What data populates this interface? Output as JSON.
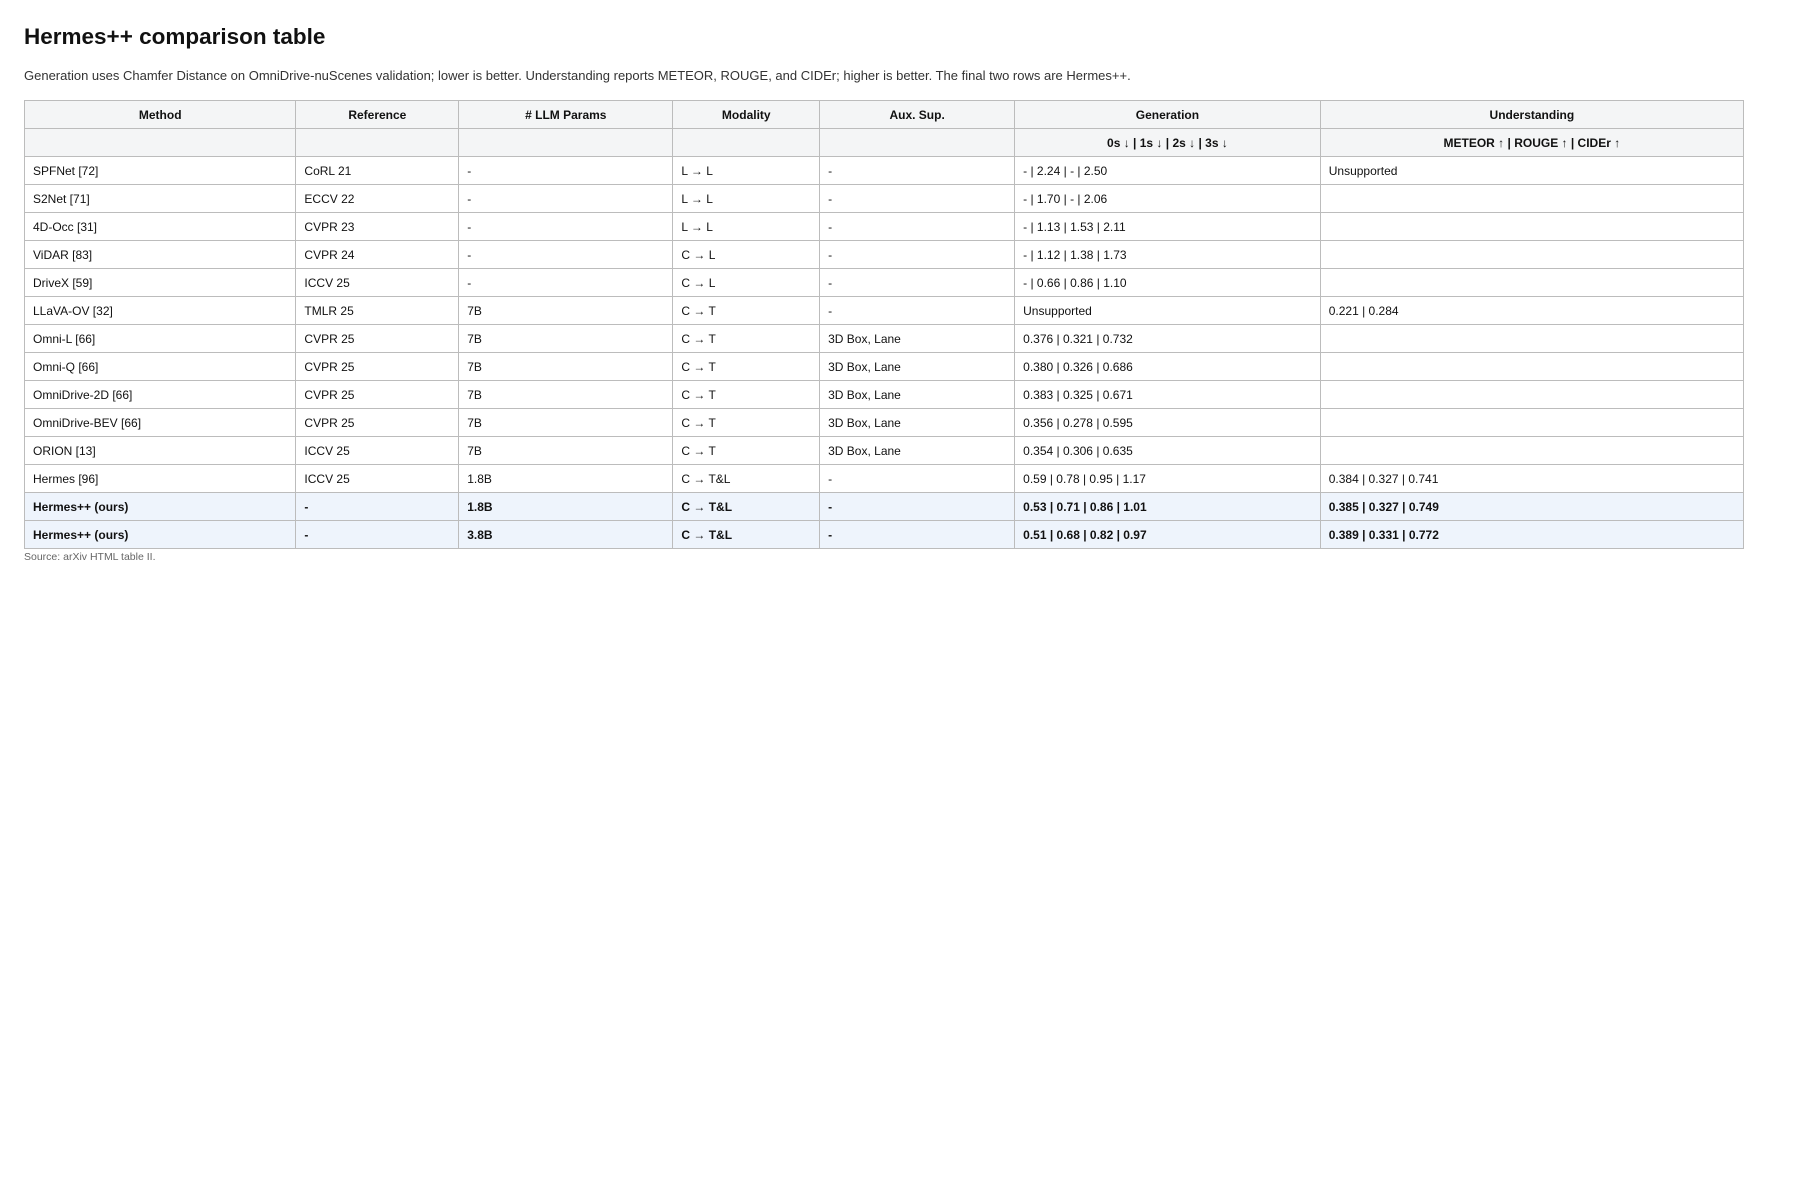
{
  "page": {
    "title": "Hermes++ comparison table",
    "caption": "Generation uses Chamfer Distance on OmniDrive-nuScenes validation; lower is better. Understanding reports METEOR, ROUGE, and CIDEr; higher is better. The final two rows are Hermes++.",
    "source": "Source: arXiv HTML table II."
  },
  "table": {
    "headers": [
      "Method",
      "Reference",
      "# LLM Params",
      "Modality",
      "Aux. Sup.",
      "Generation",
      "Understanding"
    ],
    "subheaders": [
      "",
      "",
      "",
      "",
      "",
      "0s ↓ | 1s ↓ | 2s ↓ | 3s ↓",
      "METEOR ↑ | ROUGE ↑ | CIDEr ↑"
    ],
    "rows": [
      {
        "method": "SPFNet [72]",
        "reference": "CoRL 21",
        "params": "-",
        "modality": "L → L",
        "aux": "-",
        "generation": "- | 2.24 | - | 2.50",
        "understanding": "Unsupported",
        "ours": false
      },
      {
        "method": "S2Net [71]",
        "reference": "ECCV 22",
        "params": "-",
        "modality": "L → L",
        "aux": "-",
        "generation": "- | 1.70 | - | 2.06",
        "understanding": "",
        "ours": false
      },
      {
        "method": "4D-Occ [31]",
        "reference": "CVPR 23",
        "params": "-",
        "modality": "L → L",
        "aux": "-",
        "generation": "- | 1.13 | 1.53 | 2.11",
        "understanding": "",
        "ours": false
      },
      {
        "method": "ViDAR [83]",
        "reference": "CVPR 24",
        "params": "-",
        "modality": "C → L",
        "aux": "-",
        "generation": "- | 1.12 | 1.38 | 1.73",
        "understanding": "",
        "ours": false
      },
      {
        "method": "DriveX [59]",
        "reference": "ICCV 25",
        "params": "-",
        "modality": "C → L",
        "aux": "-",
        "generation": "- | 0.66 | 0.86 | 1.10",
        "understanding": "",
        "ours": false
      },
      {
        "method": "LLaVA-OV [32]",
        "reference": "TMLR 25",
        "params": "7B",
        "modality": "C → T",
        "aux": "-",
        "generation": "Unsupported",
        "understanding": "0.221 | 0.284",
        "ours": false
      },
      {
        "method": "Omni-L [66]",
        "reference": "CVPR 25",
        "params": "7B",
        "modality": "C → T",
        "aux": "3D Box, Lane",
        "generation": "0.376 | 0.321 | 0.732",
        "understanding": "",
        "ours": false
      },
      {
        "method": "Omni-Q [66]",
        "reference": "CVPR 25",
        "params": "7B",
        "modality": "C → T",
        "aux": "3D Box, Lane",
        "generation": "0.380 | 0.326 | 0.686",
        "understanding": "",
        "ours": false
      },
      {
        "method": "OmniDrive-2D [66]",
        "reference": "CVPR 25",
        "params": "7B",
        "modality": "C → T",
        "aux": "3D Box, Lane",
        "generation": "0.383 | 0.325 | 0.671",
        "understanding": "",
        "ours": false
      },
      {
        "method": "OmniDrive-BEV [66]",
        "reference": "CVPR 25",
        "params": "7B",
        "modality": "C → T",
        "aux": "3D Box, Lane",
        "generation": "0.356 | 0.278 | 0.595",
        "understanding": "",
        "ours": false
      },
      {
        "method": "ORION [13]",
        "reference": "ICCV 25",
        "params": "7B",
        "modality": "C → T",
        "aux": "3D Box, Lane",
        "generation": "0.354 | 0.306 | 0.635",
        "understanding": "",
        "ours": false
      },
      {
        "method": "Hermes [96]",
        "reference": "ICCV 25",
        "params": "1.8B",
        "modality": "C → T&L",
        "aux": "-",
        "generation": "0.59 | 0.78 | 0.95 | 1.17",
        "understanding": "0.384 | 0.327 | 0.741",
        "ours": false
      },
      {
        "method": "Hermes++ (ours)",
        "reference": "-",
        "params": "1.8B",
        "modality": "C → T&L",
        "aux": "-",
        "generation": "0.53 | 0.71 | 0.86 | 1.01",
        "understanding": "0.385 | 0.327 | 0.749",
        "ours": true
      },
      {
        "method": "Hermes++ (ours)",
        "reference": "-",
        "params": "3.8B",
        "modality": "C → T&L",
        "aux": "-",
        "generation": "0.51 | 0.68 | 0.82 | 0.97",
        "understanding": "0.389 | 0.331 | 0.772",
        "ours": true
      }
    ]
  }
}
